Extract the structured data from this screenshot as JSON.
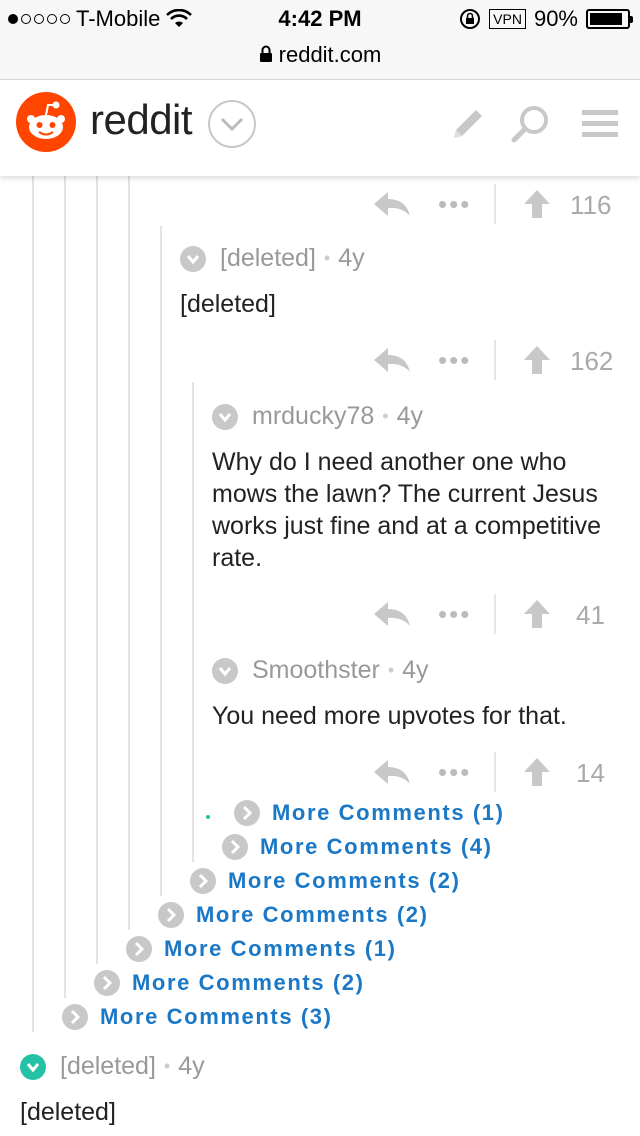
{
  "status_bar": {
    "carrier": "T-Mobile",
    "time": "4:42 PM",
    "vpn": "VPN",
    "battery": "90%",
    "battery_level": 0.9,
    "url": "reddit.com"
  },
  "header": {
    "wordmark": "reddit",
    "icons": [
      "pencil-icon",
      "search-icon",
      "menu-icon"
    ]
  },
  "comments": [
    {
      "id": "c1",
      "score": "116"
    },
    {
      "id": "c2",
      "author": "[deleted]",
      "age": "4y",
      "text": "[deleted]",
      "score": "162"
    },
    {
      "id": "c3",
      "author": "mrducky78",
      "age": "4y",
      "text": "Why do I need another one who mows the lawn? The current Jesus works just fine and at a competitive rate.",
      "score": "41"
    },
    {
      "id": "c4",
      "author": "Smoothster",
      "age": "4y",
      "text": "You need more upvotes for that.",
      "score": "14"
    },
    {
      "id": "c5",
      "author": "[deleted]",
      "age": "4y",
      "text": "[deleted]"
    }
  ],
  "more_comments": [
    "More Comments (1)",
    "More Comments (4)",
    "More Comments (2)",
    "More Comments (2)",
    "More Comments (1)",
    "More Comments (2)",
    "More Comments (3)"
  ],
  "colors": {
    "brand": "#ff4500",
    "link": "#1b78c6",
    "new_comment": "#24c1a7"
  }
}
